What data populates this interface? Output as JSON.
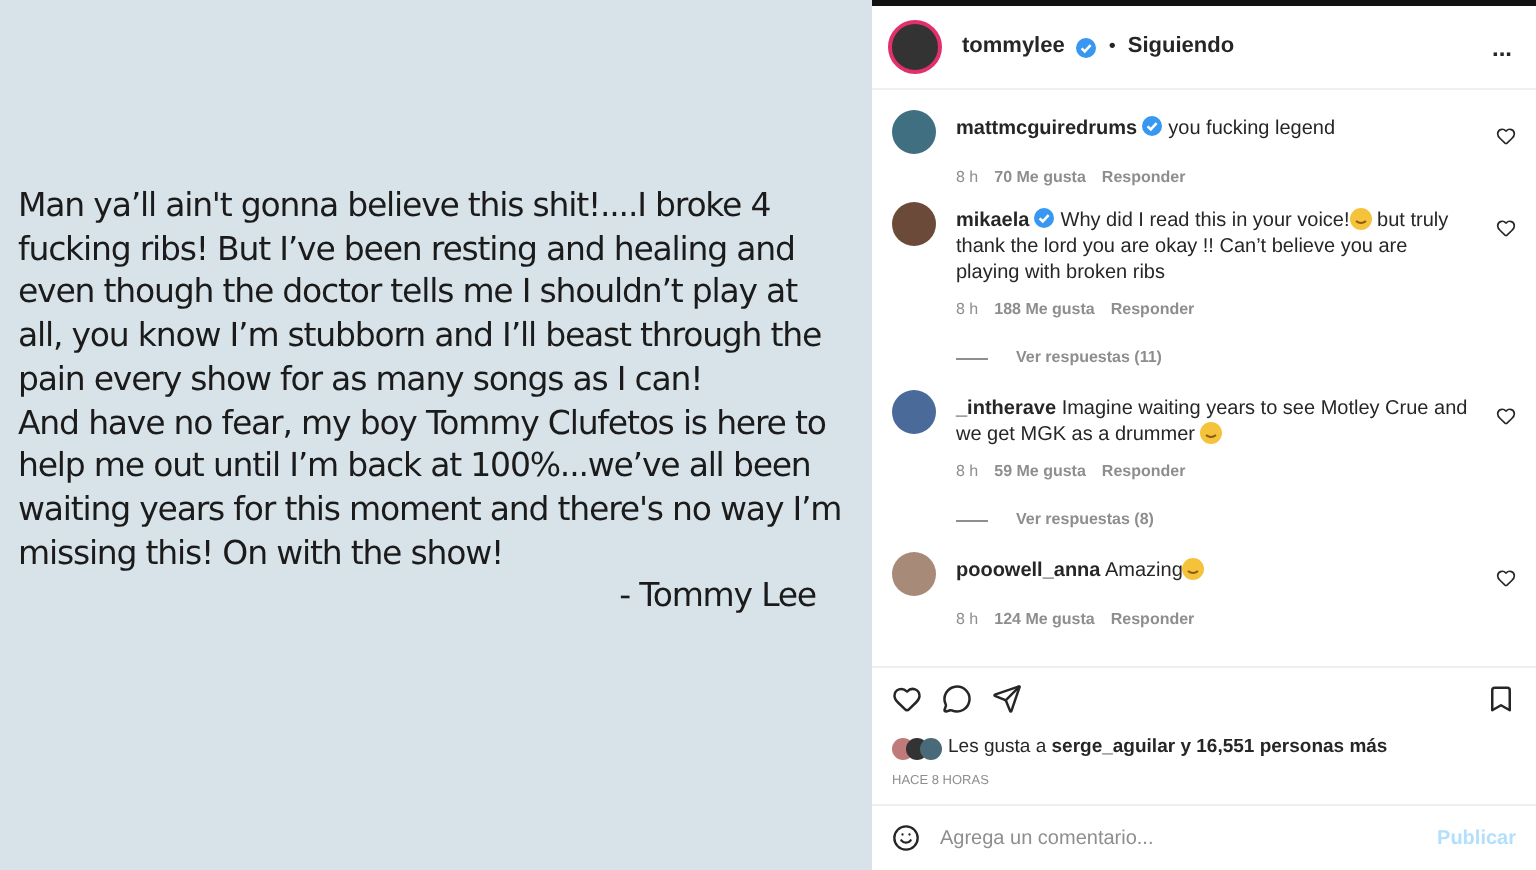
{
  "note": {
    "lines": [
      "Man ya’ll ain't gonna believe this shit!....I broke 4",
      "fucking ribs!  But I’ve been resting and healing and",
      "even though the doctor tells me I shouldn’t play at",
      "all, you know I’m stubborn and I’ll beast through the",
      "pain every show for as many songs as I can!",
      "And have no fear, my boy Tommy Clufetos is here to",
      "help me out until I’m back at 100%...we’ve all been",
      "waiting years for this moment and there's no way I’m",
      "missing this!  On with the show!"
    ],
    "signature": "- Tommy Lee"
  },
  "header": {
    "username": "tommylee",
    "verified": true,
    "separator": "•",
    "follow": "Siguiendo",
    "more": "..."
  },
  "comments": [
    {
      "username": "mattmcguiredrums",
      "verified": true,
      "segments": [
        {
          "kind": "text",
          "text": "you fucking legend"
        }
      ],
      "time": "8 h",
      "likes": "70 Me gusta",
      "reply": "Responder"
    },
    {
      "username": "mikaela",
      "verified": true,
      "segments": [
        {
          "kind": "text",
          "text": "Why did I read this in your voice!"
        },
        {
          "kind": "emoji"
        },
        {
          "kind": "text",
          "text": " but truly thank the lord you are okay !! Can’t believe you are playing with broken ribs"
        }
      ],
      "time": "8 h",
      "likes": "188 Me gusta",
      "reply": "Responder",
      "replies": "Ver respuestas (11)"
    },
    {
      "username": "_intherave",
      "verified": false,
      "segments": [
        {
          "kind": "text",
          "text": "Imagine waiting years to see Motley Crue and we get MGK as a drummer "
        },
        {
          "kind": "emoji"
        }
      ],
      "time": "8 h",
      "likes": "59 Me gusta",
      "reply": "Responder",
      "replies": "Ver respuestas (8)"
    },
    {
      "username": "pooowell_anna",
      "verified": false,
      "segments": [
        {
          "kind": "text",
          "text": "Amazing"
        },
        {
          "kind": "emoji"
        }
      ],
      "time": "8 h",
      "likes": "124 Me gusta",
      "reply": "Responder"
    }
  ],
  "likes": {
    "prefix": "Les gusta a ",
    "user": "serge_aguilar",
    "suffix": " y 16,551 personas más"
  },
  "posted": "HACE 8 HORAS",
  "comment_box": {
    "placeholder": "Agrega un comentario...",
    "submit": "Publicar"
  }
}
